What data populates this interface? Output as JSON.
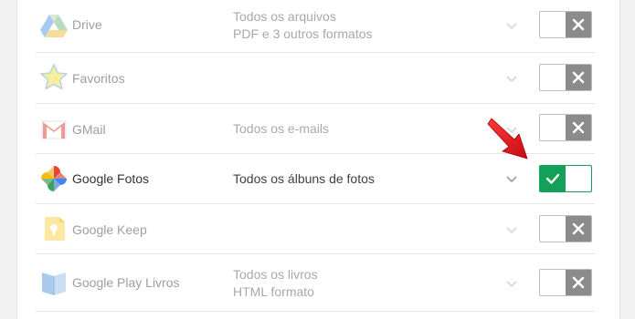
{
  "services": [
    {
      "name": "Drive",
      "desc1": "Todos os arquivos",
      "desc2": "PDF e 3 outros formatos",
      "icon": "drive-icon",
      "enabled": false
    },
    {
      "name": "Favoritos",
      "desc1": "",
      "desc2": "",
      "icon": "star-icon",
      "enabled": false
    },
    {
      "name": "GMail",
      "desc1": "Todos os e-mails",
      "desc2": "",
      "icon": "gmail-icon",
      "enabled": false
    },
    {
      "name": "Google Fotos",
      "desc1": "Todos os álbuns de fotos",
      "desc2": "",
      "icon": "google-photos-icon",
      "enabled": true
    },
    {
      "name": "Google Keep",
      "desc1": "",
      "desc2": "",
      "icon": "google-keep-icon",
      "enabled": false
    },
    {
      "name": "Google Play Livros",
      "desc1": "Todos os livros",
      "desc2": "HTML formato",
      "icon": "google-play-books-icon",
      "enabled": false
    }
  ],
  "colors": {
    "toggle_on": "#15a05a",
    "toggle_off": "#8b8b8b",
    "arrow": "#e8131b"
  }
}
